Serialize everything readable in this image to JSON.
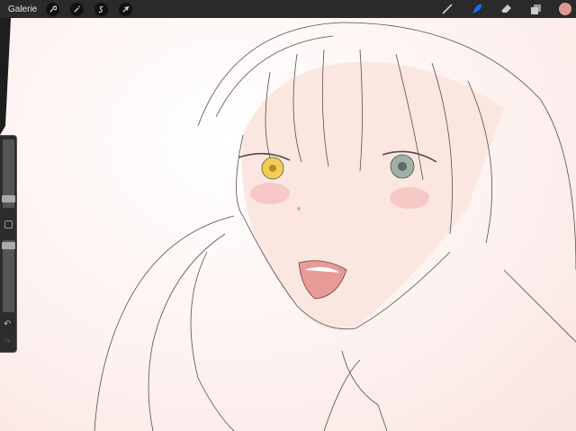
{
  "topbar": {
    "gallery_label": "Galerie",
    "left_tools": [
      "wrench-icon",
      "magic-wand-icon",
      "selection-icon",
      "transform-arrow-icon"
    ],
    "right_tools": [
      "brush-icon",
      "smudge-icon",
      "eraser-icon",
      "layers-icon",
      "color-swatch"
    ],
    "active_tool": "smudge",
    "accent_color": "#1a6cff",
    "current_color": "#e09a92"
  },
  "sidebar": {
    "brush_size": 0.2,
    "opacity": 0.9,
    "buttons": [
      "modify-square-icon",
      "undo-icon",
      "redo-icon"
    ]
  }
}
